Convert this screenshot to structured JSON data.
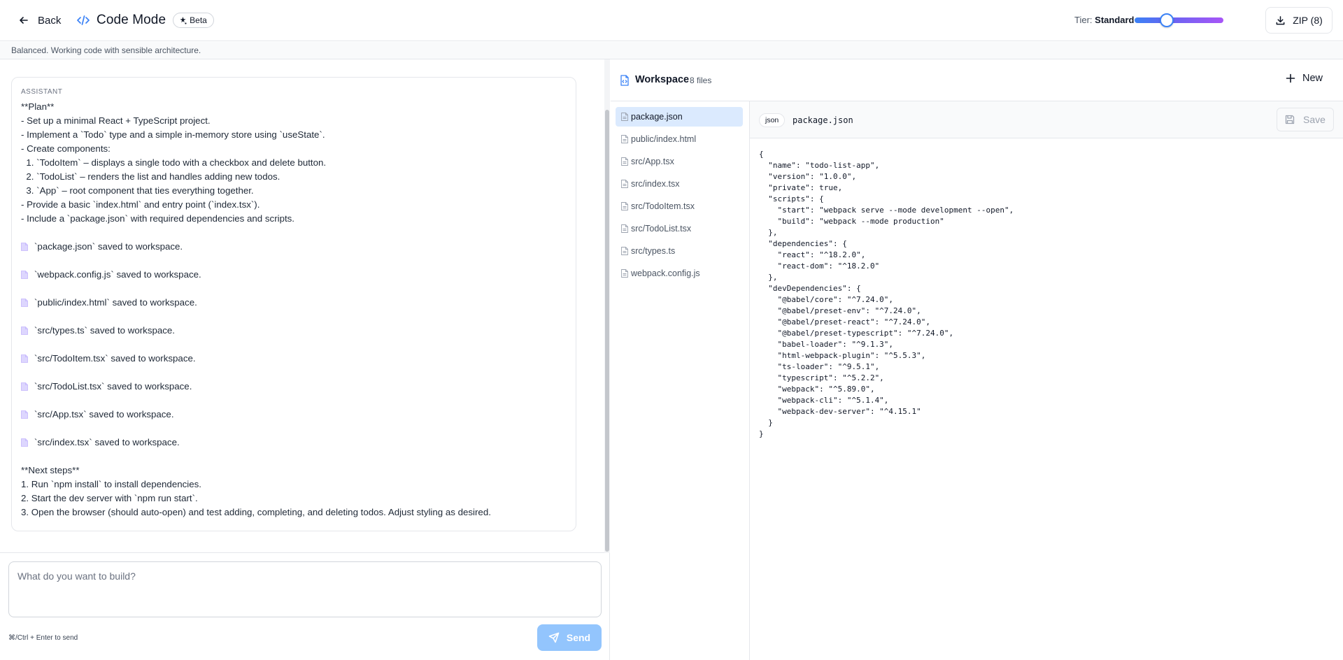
{
  "header": {
    "back_label": "Back",
    "title": "Code Mode",
    "badge": "Beta",
    "tier_label": "Tier:",
    "tier_value": "Standard",
    "tier_slider_fraction": 0.29,
    "zip_label": "ZIP (8)"
  },
  "subheader": {
    "description": "Balanced. Working code with sensible architecture."
  },
  "chat": {
    "role": "ASSISTANT",
    "plan_lines": [
      "**Plan**",
      "- Set up a minimal React + TypeScript project.",
      "- Implement a `Todo` type and a simple in-memory store using `useState`.",
      "- Create components:",
      "  1. `TodoItem` – displays a single todo with a checkbox and delete button.",
      "  2. `TodoList` – renders the list and handles adding new todos.",
      "  3. `App` – root component that ties everything together.",
      "- Provide a basic `index.html` and entry point (`index.tsx`).",
      "- Include a `package.json` with required dependencies and scripts."
    ],
    "saved_files": [
      "`package.json` saved to workspace.",
      "`webpack.config.js` saved to workspace.",
      "`public/index.html` saved to workspace.",
      "`src/types.ts` saved to workspace.",
      "`src/TodoItem.tsx` saved to workspace.",
      "`src/TodoList.tsx` saved to workspace.",
      "`src/App.tsx` saved to workspace.",
      "`src/index.tsx` saved to workspace."
    ],
    "next_lines": [
      "**Next steps**",
      "1. Run `npm install` to install dependencies.",
      "2. Start the dev server with `npm run start`.",
      "3. Open the browser (should auto-open) and test adding, completing, and deleting todos. Adjust styling as desired."
    ],
    "input_placeholder": "What do you want to build?",
    "hint": "⌘/Ctrl + Enter to send",
    "send_label": "Send"
  },
  "workspace": {
    "title": "Workspace",
    "count": "8 files",
    "new_label": "New",
    "files": [
      "package.json",
      "public/index.html",
      "src/App.tsx",
      "src/index.tsx",
      "src/TodoItem.tsx",
      "src/TodoList.tsx",
      "src/types.ts",
      "webpack.config.js"
    ],
    "active_file": "package.json"
  },
  "editor": {
    "language": "json",
    "filename": "package.json",
    "save_label": "Save",
    "code": "{\n  \"name\": \"todo-list-app\",\n  \"version\": \"1.0.0\",\n  \"private\": true,\n  \"scripts\": {\n    \"start\": \"webpack serve --mode development --open\",\n    \"build\": \"webpack --mode production\"\n  },\n  \"dependencies\": {\n    \"react\": \"^18.2.0\",\n    \"react-dom\": \"^18.2.0\"\n  },\n  \"devDependencies\": {\n    \"@babel/core\": \"^7.24.0\",\n    \"@babel/preset-env\": \"^7.24.0\",\n    \"@babel/preset-react\": \"^7.24.0\",\n    \"@babel/preset-typescript\": \"^7.24.0\",\n    \"babel-loader\": \"^9.1.3\",\n    \"html-webpack-plugin\": \"^5.5.3\",\n    \"ts-loader\": \"^9.5.1\",\n    \"typescript\": \"^5.2.2\",\n    \"webpack\": \"^5.89.0\",\n    \"webpack-cli\": \"^5.1.4\",\n    \"webpack-dev-server\": \"^4.15.1\"\n  }\n}"
  },
  "colors": {
    "accent": "#3b82f6",
    "accent_purple": "#a855f7",
    "active_file_bg": "#dbeafe",
    "send_button": "#93c5fd",
    "file_icon": "#c4b5fd"
  },
  "icons": {
    "back": "arrow-left-icon",
    "title": "code-icon",
    "beta": "sparkle-icon",
    "zip": "download-icon",
    "workspace": "file-code-icon",
    "new": "plus-icon",
    "file": "file-icon",
    "save": "save-icon",
    "send": "send-icon"
  }
}
